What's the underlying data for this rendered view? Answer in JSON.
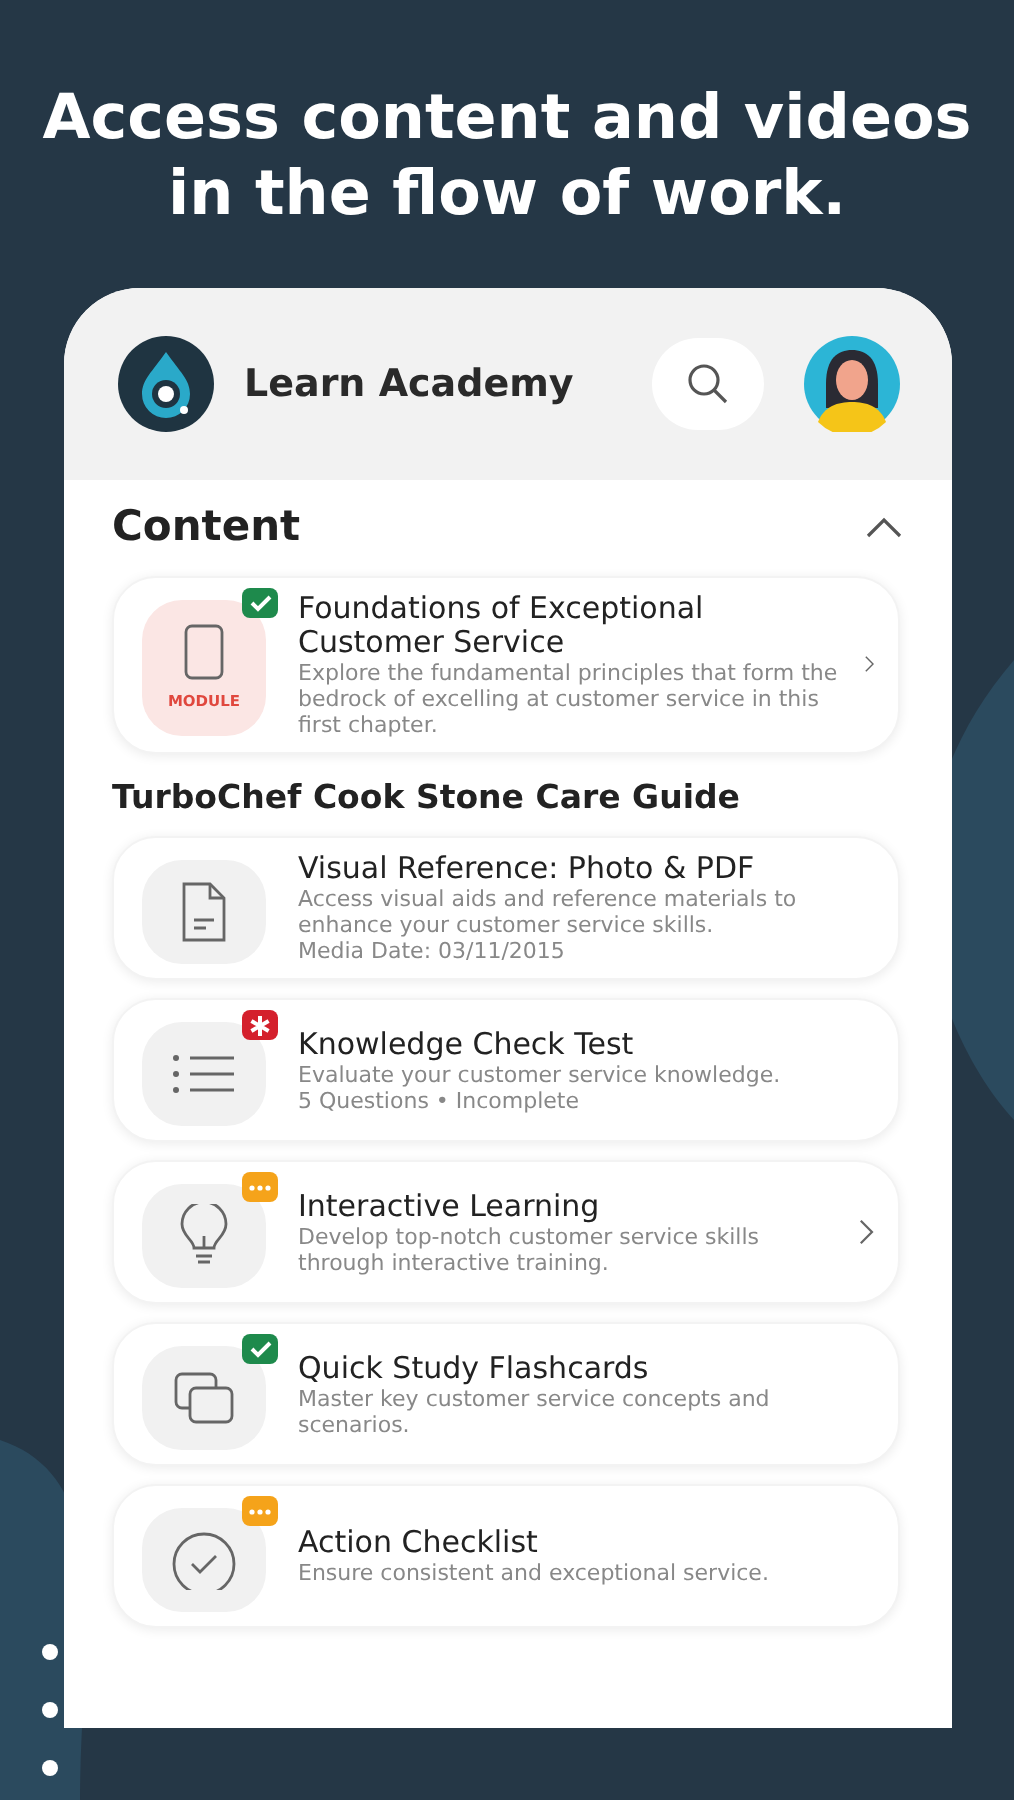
{
  "headline": "Access content and videos in the flow of work.",
  "app": {
    "title": "Learn Academy"
  },
  "section": {
    "title": "Content",
    "expanded": true
  },
  "featured": {
    "kind": "module",
    "label": "MODULE",
    "badge": {
      "kind": "complete"
    },
    "title": "Foundations of Exceptional Customer Service",
    "lines": [
      "Explore the fundamental principles that form the bedrock of excelling at customer service in this first chapter."
    ],
    "chevron": true
  },
  "group": {
    "title": "TurboChef Cook Stone Care Guide",
    "items": [
      {
        "kind": "document",
        "title": "Visual Reference: Photo & PDF",
        "lines": [
          "Access visual aids and reference materials to enhance your customer service skills.",
          "Media Date: 03/11/2015"
        ],
        "chevron": false
      },
      {
        "kind": "list",
        "badge": {
          "kind": "required"
        },
        "title": "Knowledge Check Test",
        "lines": [
          "Evaluate your customer service knowledge.",
          "5 Questions • Incomplete"
        ],
        "chevron": false
      },
      {
        "kind": "bulb",
        "badge": {
          "kind": "in_progress"
        },
        "title": "Interactive Learning",
        "lines": [
          "Develop top-notch customer service skills through interactive training."
        ],
        "chevron": true
      },
      {
        "kind": "cards",
        "badge": {
          "kind": "complete"
        },
        "title": "Quick Study Flashcards",
        "lines": [
          "Master key customer service concepts and scenarios."
        ],
        "chevron": false
      },
      {
        "kind": "check",
        "badge": {
          "kind": "in_progress"
        },
        "title": "Action Checklist",
        "lines": [
          "Ensure consistent and exceptional service."
        ],
        "chevron": false
      }
    ]
  }
}
